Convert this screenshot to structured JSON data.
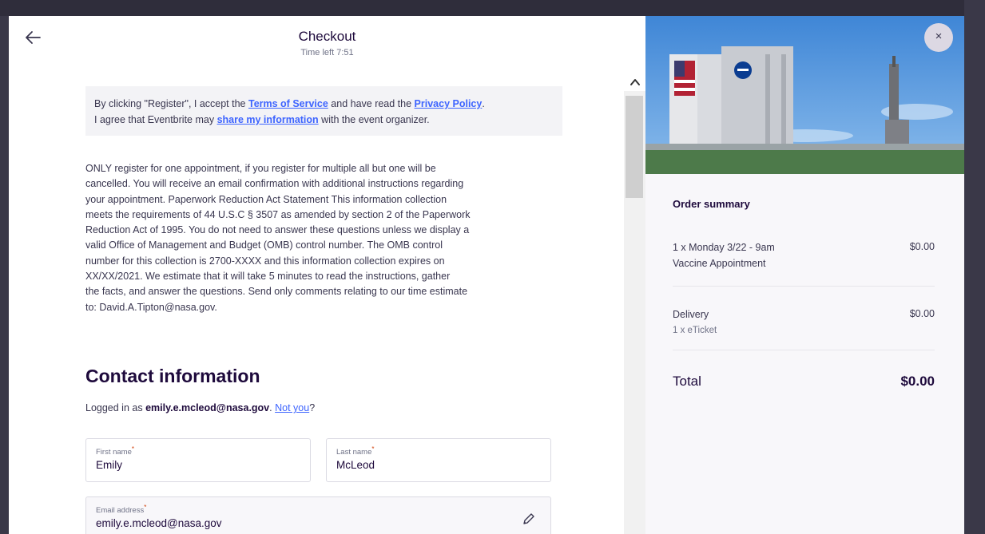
{
  "header": {
    "title": "Checkout",
    "timer": "Time left 7:51"
  },
  "notice": {
    "part1": "By clicking \"Register\", I accept the ",
    "terms_link": "Terms of Service",
    "part2": " and have read the ",
    "privacy_link": "Privacy Policy",
    "part3": ".",
    "part4": "I agree that Eventbrite may ",
    "share_link": "share my information",
    "part5": " with the event organizer."
  },
  "info_lines": [
    "ONLY register for one appointment, if you register for multiple all but one will be",
    "cancelled. You will receive an email confirmation with additional instructions regarding",
    "your appointment. Paperwork Reduction Act Statement This information collection",
    "meets the requirements of 44 U.S.C § 3507 as amended by section 2 of the Paperwork",
    "Reduction Act of 1995. You do not need to answer these questions unless we display a",
    "valid Office of Management and Budget (OMB) control number. The OMB control",
    "number for this collection is 2700-XXXX and this information collection expires on",
    "XX/XX/2021. We estimate that it will take 5 minutes to read the instructions, gather",
    "the facts, and answer the questions. Send only comments relating to our time estimate",
    "to: David.A.Tipton@nasa.gov."
  ],
  "contact": {
    "title": "Contact information",
    "logged_prefix": "Logged in as ",
    "email_bold": "emily.e.mcleod@nasa.gov",
    "logged_sep": ". ",
    "not_you": "Not you",
    "logged_suffix": "?",
    "first_name_label": "First name",
    "first_name_value": "Emily",
    "last_name_label": "Last name",
    "last_name_value": "McLeod",
    "email_label": "Email address",
    "email_value": "emily.e.mcleod@nasa.gov",
    "required_mark": "*"
  },
  "close_label": "×",
  "summary": {
    "title": "Order summary",
    "item_line1": "1 x Monday 3/22 - 9am",
    "item_line2": "Vaccine Appointment",
    "item_price": "$0.00",
    "delivery_label": "Delivery",
    "delivery_sub": "1 x eTicket",
    "delivery_price": "$0.00",
    "total_label": "Total",
    "total_price": "$0.00"
  },
  "icons": {
    "back": "arrow-left-icon",
    "close": "close-icon",
    "edit": "pencil-icon",
    "scroll_up": "chevron-up-icon"
  },
  "colors": {
    "link": "#3d64ff",
    "heading": "#1e0a3c",
    "required": "#d1410c"
  }
}
